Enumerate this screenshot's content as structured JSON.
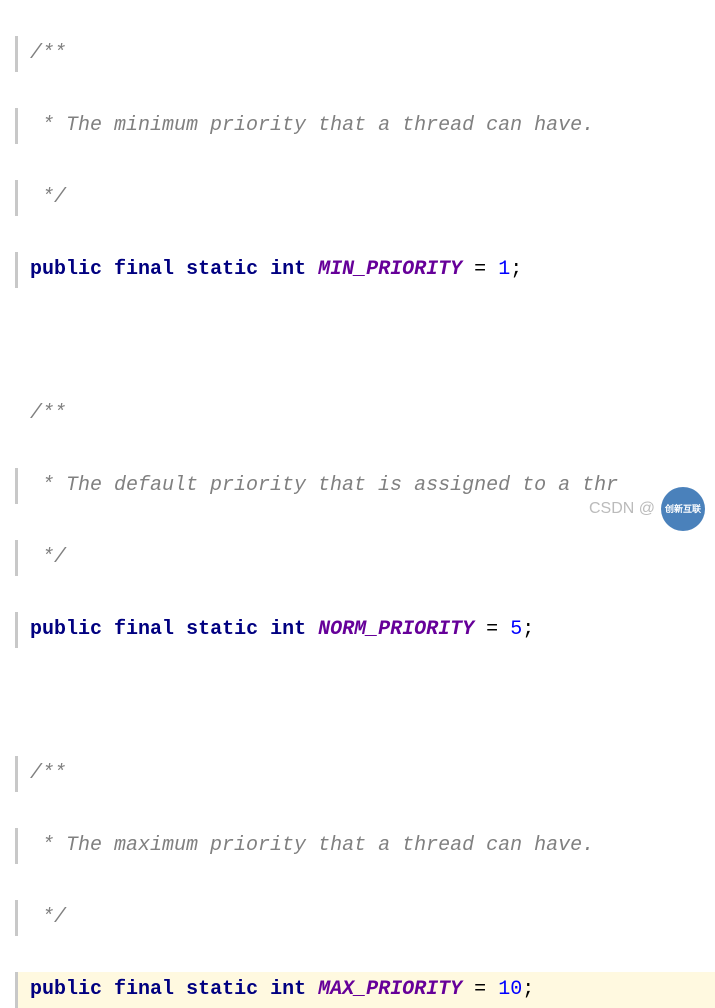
{
  "lines": {
    "c1_open": "/**",
    "c1_body": " * The minimum priority that a thread can have.",
    "c1_close": " */",
    "decl1_kw1": "public",
    "decl1_kw2": "final",
    "decl1_kw3": "static",
    "decl1_kw4": "int",
    "decl1_const": "MIN_PRIORITY",
    "decl1_eq": " = ",
    "decl1_num": "1",
    "decl1_semi": ";",
    "c2_open": " /**",
    "c2_body": "  * The default priority that is assigned to a thr",
    "c2_close": "  */",
    "decl2_kw1": "public",
    "decl2_kw2": "final",
    "decl2_kw3": "static",
    "decl2_kw4": "int",
    "decl2_const": "NORM_PRIORITY",
    "decl2_eq": " = ",
    "decl2_num": "5",
    "decl2_semi": ";",
    "c3_open": "/**",
    "c3_body": " * The maximum priority that a thread can have.",
    "c3_close": " */",
    "decl3_kw1": "public",
    "decl3_kw2": "final",
    "decl3_kw3": "static",
    "decl3_kw4": "int",
    "decl3_const": "MAX_PRIORITY",
    "decl3_eq": " = ",
    "decl3_num": "10",
    "decl3_semi": ";"
  },
  "watermark": {
    "text": "CSDN @",
    "logo": "创新互联"
  }
}
